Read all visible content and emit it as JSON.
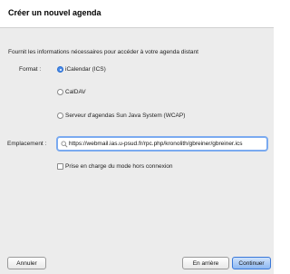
{
  "dialog": {
    "title": "Créer un nouvel agenda",
    "description": "Fournit les informations nécessaires pour accéder à votre agenda distant"
  },
  "format": {
    "label": "Format :",
    "options": [
      {
        "label": "iCalendar (ICS)",
        "selected": true
      },
      {
        "label": "CalDAV",
        "selected": false
      },
      {
        "label": "Serveur d'agendas Sun Java System (WCAP)",
        "selected": false
      }
    ]
  },
  "location": {
    "label": "Emplacement :",
    "value": "https://webmail.ias.u-psud.fr/rpc.php/kronolith/gbreiner/gbreiner.ics"
  },
  "offline": {
    "label": "Prise en charge du mode hors connexion",
    "checked": false
  },
  "buttons": {
    "cancel": "Annuler",
    "back": "En arrière",
    "continue": "Continuer"
  },
  "colors": {
    "accent": "#4a8ae8",
    "focus_ring": "#7aaaf0",
    "background": "#ececec"
  }
}
